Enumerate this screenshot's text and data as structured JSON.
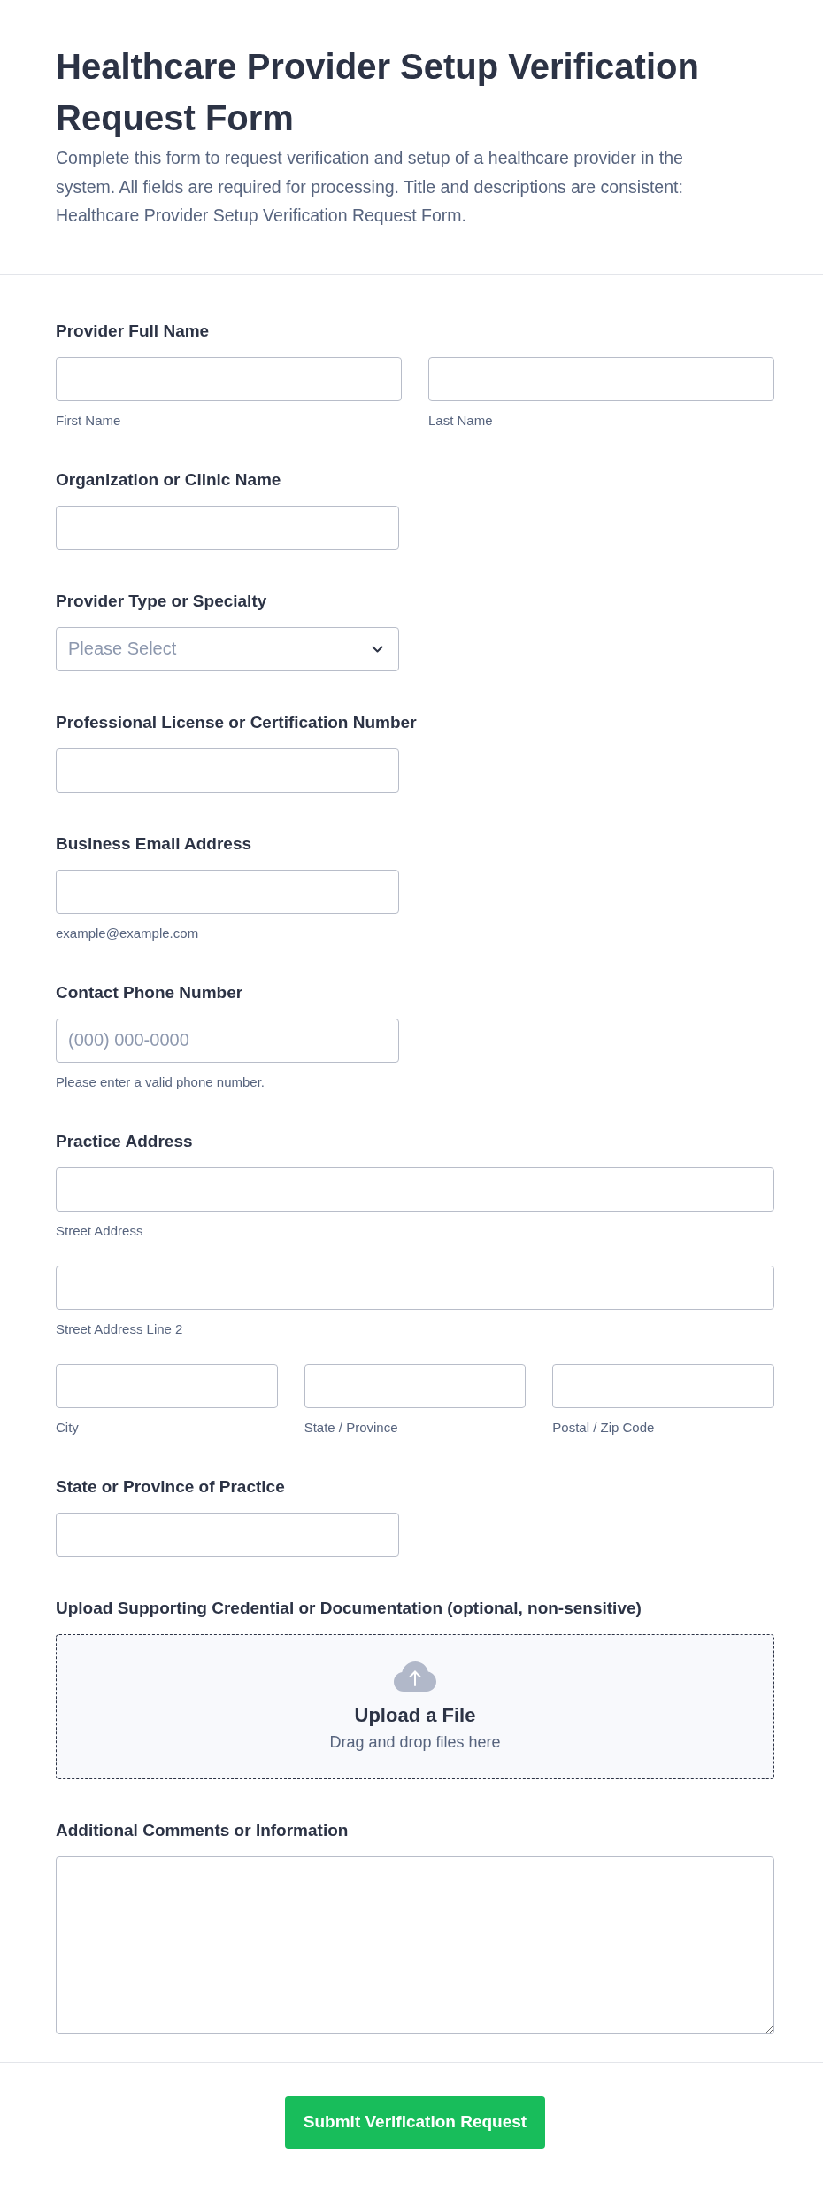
{
  "header": {
    "title": "Healthcare Provider Setup Verification Request Form",
    "description": "Complete this form to request verification and setup of a healthcare provider in the system. All fields are required for processing. Title and descriptions are consistent: Healthcare Provider Setup Verification Request Form."
  },
  "fields": [
    {
      "kind": "group",
      "label": "Provider Full Name",
      "rows": [
        [
          {
            "sublabel": "First Name"
          },
          {
            "sublabel": "Last Name"
          }
        ]
      ]
    },
    {
      "kind": "text",
      "label": "Organization or Clinic Name"
    },
    {
      "kind": "select",
      "label": "Provider Type or Specialty",
      "placeholder": "Please Select"
    },
    {
      "kind": "text",
      "label": "Professional License or Certification Number"
    },
    {
      "kind": "text",
      "label": "Business Email Address",
      "hint": "example@example.com"
    },
    {
      "kind": "text",
      "label": "Contact Phone Number",
      "placeholder": "(000) 000-0000",
      "hint": "Please enter a valid phone number."
    },
    {
      "kind": "group",
      "label": "Practice Address",
      "rows": [
        [
          {
            "sublabel": "Street Address"
          }
        ],
        [
          {
            "sublabel": "Street Address Line 2"
          }
        ],
        [
          {
            "sublabel": "City"
          },
          {
            "sublabel": "State / Province"
          },
          {
            "sublabel": "Postal / Zip Code"
          }
        ]
      ]
    },
    {
      "kind": "text",
      "label": "State or Province of Practice"
    },
    {
      "kind": "upload",
      "label": "Upload Supporting Credential or Documentation (optional, non-sensitive)",
      "title": "Upload a File",
      "subtitle": "Drag and drop files here"
    },
    {
      "kind": "textarea",
      "label": "Additional Comments or Information"
    }
  ],
  "submit": {
    "label": "Submit Verification Request"
  }
}
